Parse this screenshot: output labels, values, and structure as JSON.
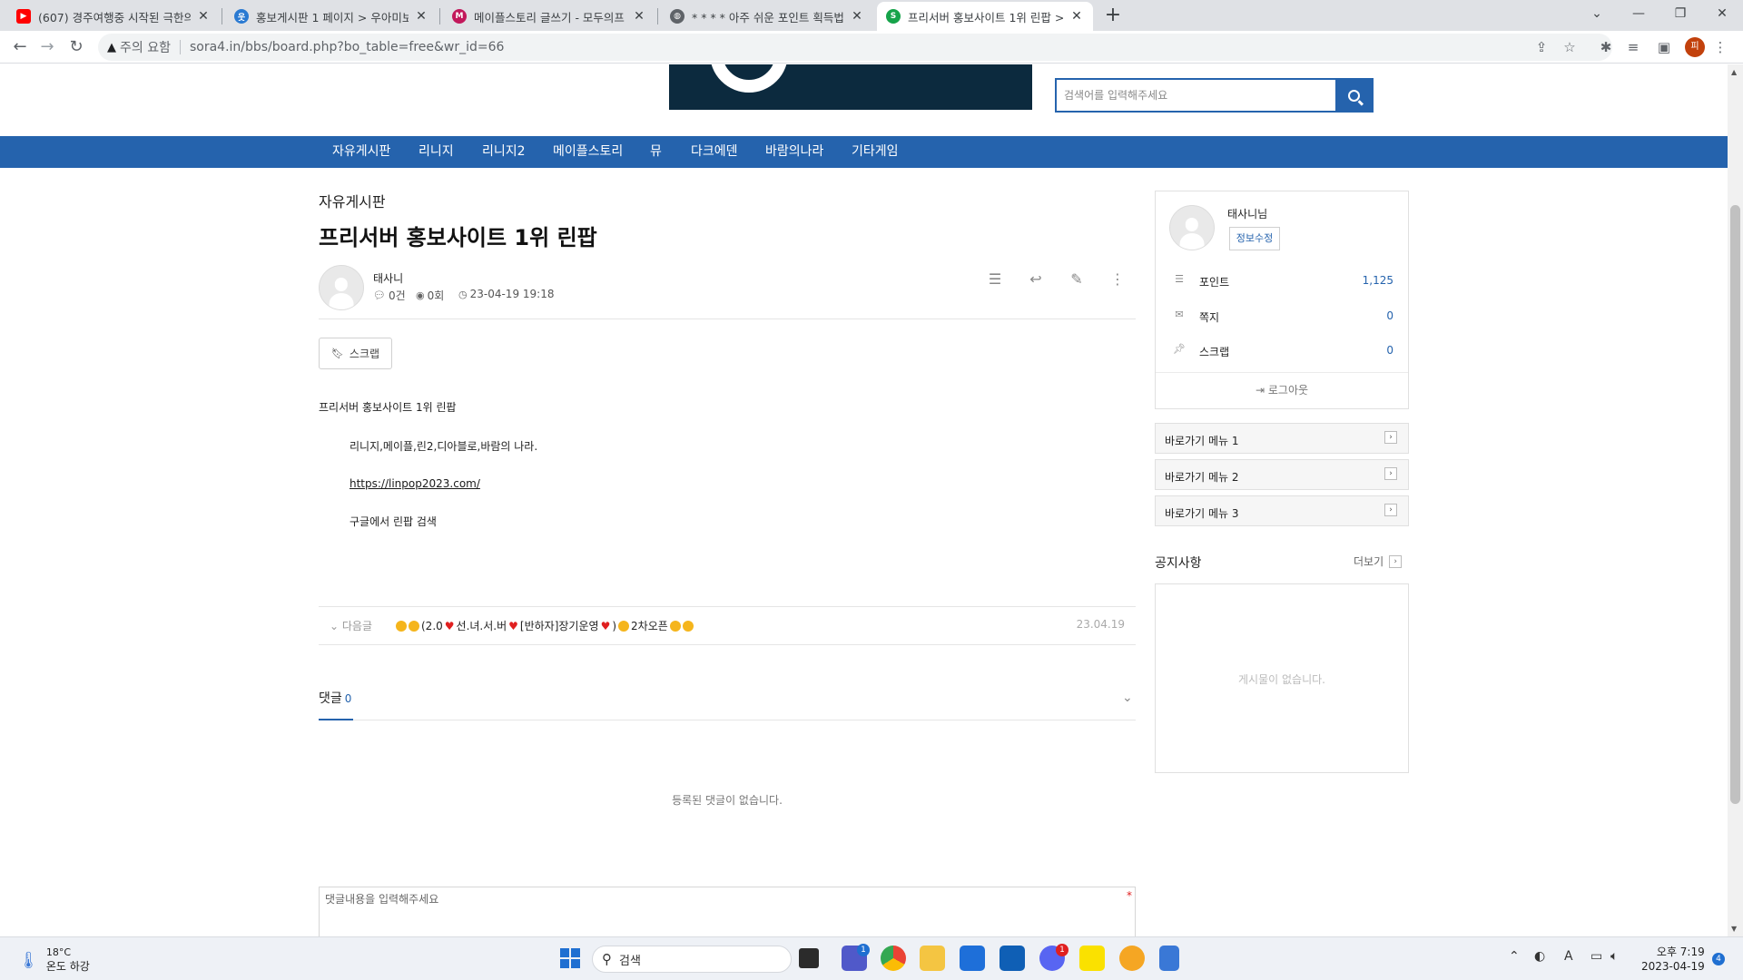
{
  "browser": {
    "tabs": [
      {
        "title": "(607) 경주여행중 시작된 극한의",
        "favicon": "youtube-icon",
        "color": "#ff0000"
      },
      {
        "title": "홍보게시판 1 페이지 > 우아미보",
        "favicon": "uami-icon",
        "color": "#2a7ad2"
      },
      {
        "title": "메이플스토리 글쓰기 - 모두의프",
        "favicon": "maple-icon",
        "color": "#c2185b"
      },
      {
        "title": "* * * * 아주 쉬운 포인트 획득법",
        "favicon": "globe-icon",
        "color": "#5f6368"
      },
      {
        "title": "프리서버 홍보사이트 1위 린팝 >",
        "favicon": "sora-icon",
        "color": "#16a34a"
      }
    ],
    "security_label": "주의 요함",
    "url": "sora4.in/bbs/board.php?bo_table=free&wr_id=66",
    "profile_initial": "피"
  },
  "header": {
    "search_placeholder": "검색어를 입력해주세요"
  },
  "nav": [
    "자유게시판",
    "리니지",
    "리니지2",
    "메이플스토리",
    "뮤",
    "다크에덴",
    "바람의나라",
    "기타게임"
  ],
  "post": {
    "board": "자유게시판",
    "title": "프리서버 홍보사이트 1위 린팝",
    "author": "태사니",
    "comments_meta": "0건",
    "views_meta": "0회",
    "datetime": "23-04-19 19:18",
    "scrap_label": "스크랩",
    "body": [
      "프리서버 홍보사이트 1위 린팝",
      "리니지,메이플,린2,디아블로,바람의 나라.",
      "https://linpop2023.com/",
      "구글에서 린팝 검색"
    ]
  },
  "next_post": {
    "label": "다음글",
    "title_a": "(2.0",
    "title_b": "선.녀.서.버",
    "title_c": "[반하자]장기운영",
    "title_d": "2차오픈",
    "date": "23.04.19"
  },
  "comments": {
    "heading": "댓글",
    "count": "0",
    "empty": "등록된 댓글이 없습니다.",
    "placeholder": "댓글내용을 입력해주세요",
    "required_mark": "*"
  },
  "sidebar": {
    "user_name": "태사니님",
    "edit_label": "정보수정",
    "rows": [
      {
        "icon": "database-icon",
        "label": "포인트",
        "value": "1,125"
      },
      {
        "icon": "envelope-icon",
        "label": "쪽지",
        "value": "0"
      },
      {
        "icon": "pin-icon",
        "label": "스크랩",
        "value": "0"
      }
    ],
    "logout_label": "로그아웃",
    "quick_links": [
      "바로가기 메뉴 1",
      "바로가기 메뉴 2",
      "바로가기 메뉴 3"
    ],
    "notice_title": "공지사항",
    "notice_more": "더보기",
    "notice_empty": "게시물이 없습니다."
  },
  "taskbar": {
    "temperature": "18°C",
    "weather_text": "온도 하강",
    "search_label": "검색",
    "clock_time": "오후 7:19",
    "clock_date": "2023-04-19",
    "notification_count": "4",
    "teams_badge": "1",
    "discord_badge": "1"
  },
  "colors": {
    "brand_blue": "#2563ad",
    "logo_navy": "#0c2a3e"
  }
}
